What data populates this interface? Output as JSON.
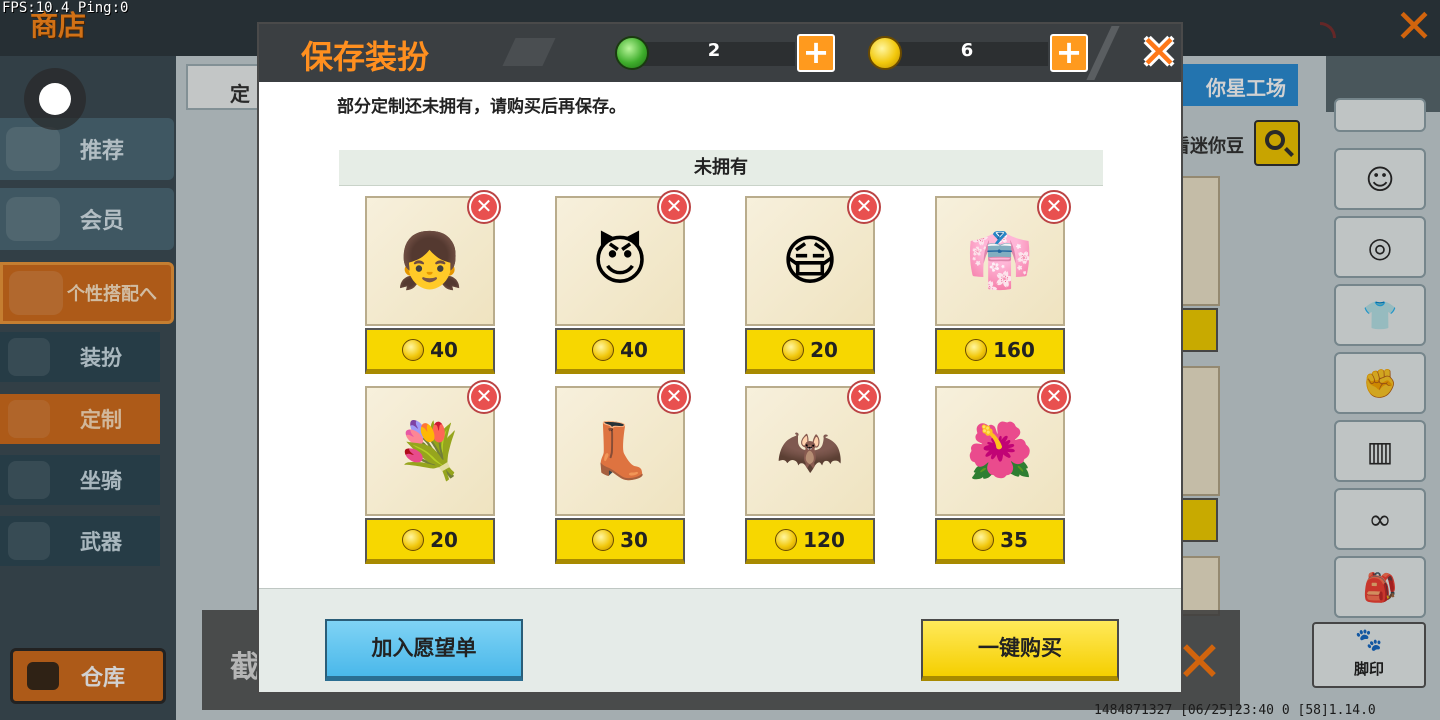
{
  "debug": {
    "fps": "FPS:10.4  Ping:0"
  },
  "background": {
    "title": "商店",
    "tab_left": "定",
    "tab_right": "你星工场",
    "search_label": "看迷你豆",
    "banner_text": "截",
    "footprint_label": "脚印",
    "bottom_info": "1484871327  [06/25]23:40 0  [58]1.14.0",
    "sidebar": {
      "items": [
        {
          "label": "推荐"
        },
        {
          "label": "会员"
        },
        {
          "label": "个性搭配へ"
        }
      ],
      "subitems": [
        {
          "label": "装扮"
        },
        {
          "label": "定制"
        },
        {
          "label": "坐骑"
        },
        {
          "label": "武器"
        }
      ],
      "warehouse": "仓库"
    }
  },
  "modal": {
    "title": "保存装扮",
    "currency": {
      "gems": "2",
      "coins": "6"
    },
    "notice": "部分定制还未拥有，请购买后再保存。",
    "section_title": "未拥有",
    "items": [
      {
        "icon": "hair-icon",
        "art": "👧",
        "price": "40"
      },
      {
        "icon": "face-icon",
        "art": "😈",
        "price": "40"
      },
      {
        "icon": "mask-icon",
        "art": "😷",
        "price": "20"
      },
      {
        "icon": "outfit-icon",
        "art": "👘",
        "price": "160"
      },
      {
        "icon": "bouquet-icon",
        "art": "💐",
        "price": "20"
      },
      {
        "icon": "shoes-icon",
        "art": "👢",
        "price": "30"
      },
      {
        "icon": "wings-icon",
        "art": "🦇",
        "price": "120"
      },
      {
        "icon": "flowers-icon",
        "art": "🌺",
        "price": "35"
      }
    ],
    "wishlist_button": "加入愿望单",
    "buy_button": "一键购买"
  }
}
